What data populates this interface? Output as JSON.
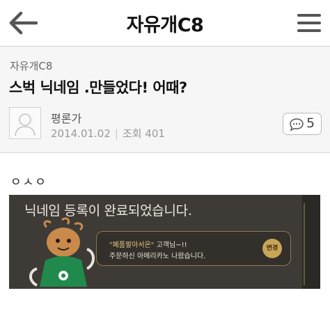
{
  "topbar": {
    "title": "자유개C8",
    "back_icon": "arrow-left-icon",
    "menu_icon": "hamburger-menu-icon"
  },
  "post": {
    "board": "자유개C8",
    "title": "스벅 닉네임 .만들었다! 어때?",
    "author": "평론가",
    "date": "2014.01.02",
    "views_label": "조회",
    "views": "401",
    "comment_count": "5",
    "body": "ㅇㅅㅇ"
  },
  "notice": {
    "heading": "닉네임 등록이 완료되었습니다.",
    "nickname": "\"폐품팔아서온\"",
    "line1_suffix": " 고객님~!!",
    "line2": "주문하신 아메리카노 나왔습니다.",
    "change_label": "변경"
  },
  "colors": {
    "notice_bg": "#3e3b36",
    "accent_gold": "#c8a455",
    "mascot_green": "#1f8a4c"
  }
}
